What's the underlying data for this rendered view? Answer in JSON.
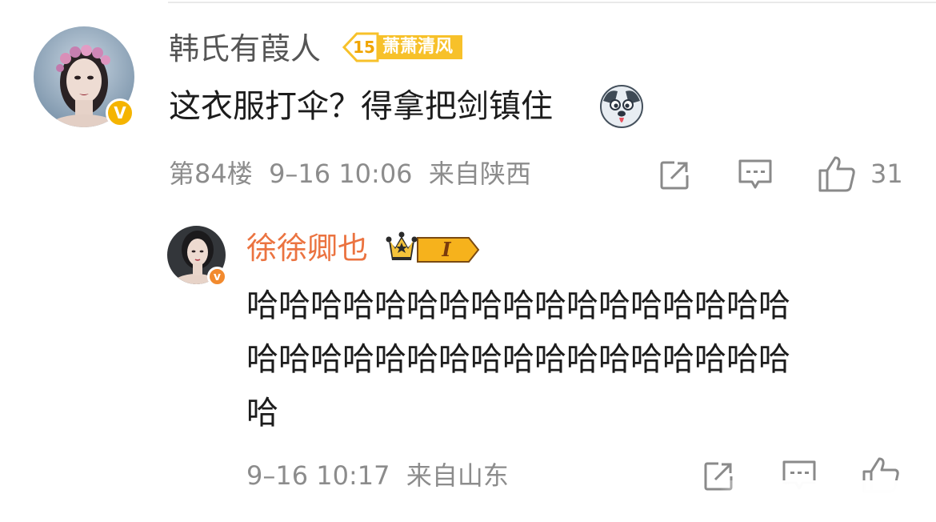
{
  "comment": {
    "username": "韩氏有葭人",
    "fan_badge": {
      "level": "15",
      "label": "萧萧清风"
    },
    "verified_mark": "V",
    "text": "这衣服打伞？得拿把剑镇住",
    "emoji": "husky-dog-emoji",
    "meta": "第84楼  9–16 10:06  来自陕西",
    "like_count": "31"
  },
  "reply": {
    "username": "徐徐卿也",
    "membership_level": "I",
    "verified_mark": "v",
    "text_line_1": "哈哈哈哈哈哈哈哈哈哈哈哈哈哈哈哈哈",
    "text_line_2": "哈哈哈哈哈哈哈哈哈哈哈哈哈哈哈哈哈",
    "text_line_3": "哈",
    "meta": "9–16 10:17  来自山东"
  },
  "colors": {
    "username_gray": "#555555",
    "username_orange": "#eb7340",
    "meta_gray": "#8c8c8c",
    "verified_gold": "#f5b400",
    "verified_orange": "#f28a2e",
    "badge_gold": "#f7c12a"
  },
  "icons": {
    "share": "share-icon",
    "comment": "comment-icon",
    "like": "thumbs-up-icon",
    "crown": "crown-icon"
  }
}
